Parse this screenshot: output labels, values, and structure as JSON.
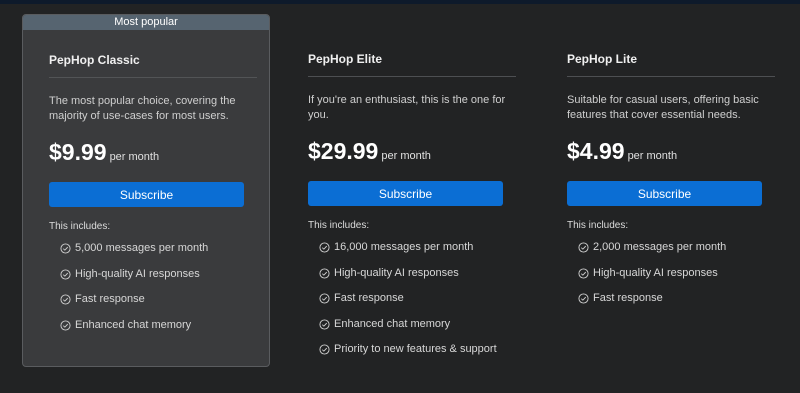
{
  "colors": {
    "background": "#222324",
    "popular_card": "#3a3b3d",
    "badge": "#566470",
    "accent": "#0b6ed4"
  },
  "plans": [
    {
      "badge": "Most popular",
      "name": "PepHop Classic",
      "description": "The most popular choice, covering the majority of use-cases for most users.",
      "price": "$9.99",
      "period": "per month",
      "button": "Subscribe",
      "includes_label": "This includes:",
      "features": [
        "5,000 messages per month",
        "High-quality AI responses",
        "Fast response",
        "Enhanced chat memory"
      ]
    },
    {
      "name": "PepHop Elite",
      "description": "If you're an enthusiast, this is the one for you.",
      "price": "$29.99",
      "period": "per month",
      "button": "Subscribe",
      "includes_label": "This includes:",
      "features": [
        "16,000 messages per month",
        "High-quality AI responses",
        "Fast response",
        "Enhanced chat memory",
        "Priority to new features & support"
      ]
    },
    {
      "name": "PepHop Lite",
      "description": "Suitable for casual users, offering basic features that cover essential needs.",
      "price": "$4.99",
      "period": "per month",
      "button": "Subscribe",
      "includes_label": "This includes:",
      "features": [
        "2,000 messages per month",
        "High-quality AI responses",
        "Fast response"
      ]
    }
  ],
  "icons": {
    "feature": "check-circle-icon"
  }
}
